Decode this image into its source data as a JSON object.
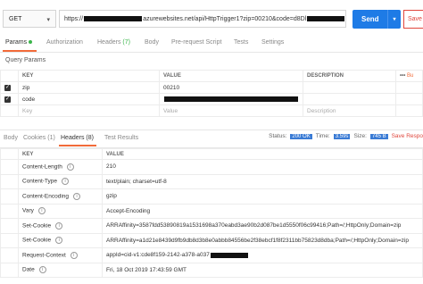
{
  "request": {
    "method": "GET",
    "url_prefix": "https://",
    "url_mid": "azurewebsites.net/api/HttpTrigger1?zip=00210&code=d8Dl",
    "send_label": "Send",
    "save_label": "Save"
  },
  "req_tabs": {
    "params": "Params",
    "authorization": "Authorization",
    "headers": "Headers",
    "headers_count": "(7)",
    "body": "Body",
    "prerequest": "Pre-request Script",
    "tests": "Tests",
    "settings": "Settings"
  },
  "query_params": {
    "section_title": "Query Params",
    "col_key": "KEY",
    "col_value": "VALUE",
    "col_description": "DESCRIPTION",
    "more": "•••",
    "bulk_edit": "Bu",
    "rows": [
      {
        "key": "zip",
        "value": "00210",
        "checked": true
      },
      {
        "key": "code",
        "value": "",
        "checked": true
      }
    ],
    "placeholder_key": "Key",
    "placeholder_value": "Value",
    "placeholder_description": "Description"
  },
  "response_tabs": {
    "body": "Body",
    "cookies": "Cookies (1)",
    "headers": "Headers (8)",
    "test_results": "Test Results"
  },
  "status": {
    "status_label": "Status:",
    "status_value": "200 OK",
    "time_label": "Time:",
    "time_value": "3.59s",
    "size_label": "Size:",
    "size_value": "745 B",
    "save_response": "Save Respo"
  },
  "response_headers": {
    "col_key": "KEY",
    "col_value": "VALUE",
    "rows": [
      {
        "key": "Content-Length",
        "value": "210"
      },
      {
        "key": "Content-Type",
        "value": "text/plain; charset=utf-8"
      },
      {
        "key": "Content-Encoding",
        "value": "gzip"
      },
      {
        "key": "Vary",
        "value": "Accept-Encoding"
      },
      {
        "key": "Set-Cookie",
        "value": "ARRAffinity=3587fdd53890819a1531698a370eabd3ae90b2d087be1d5550f06c99416;Path=/;HttpOnly;Domain=zip"
      },
      {
        "key": "Set-Cookie",
        "value": "ARRAffinity=a1d21e8439d9fb9db8d3b8e0abbb84556be2f38ebcf1f8f2311bb75823d8dba;Path=/;HttpOnly;Domain=zip"
      },
      {
        "key": "Request-Context",
        "value": "appId=cid-v1:cde8f159-2142-a378-a037"
      },
      {
        "key": "Date",
        "value": "Fri, 18 Oct 2019 17:43:59 GMT"
      }
    ]
  }
}
